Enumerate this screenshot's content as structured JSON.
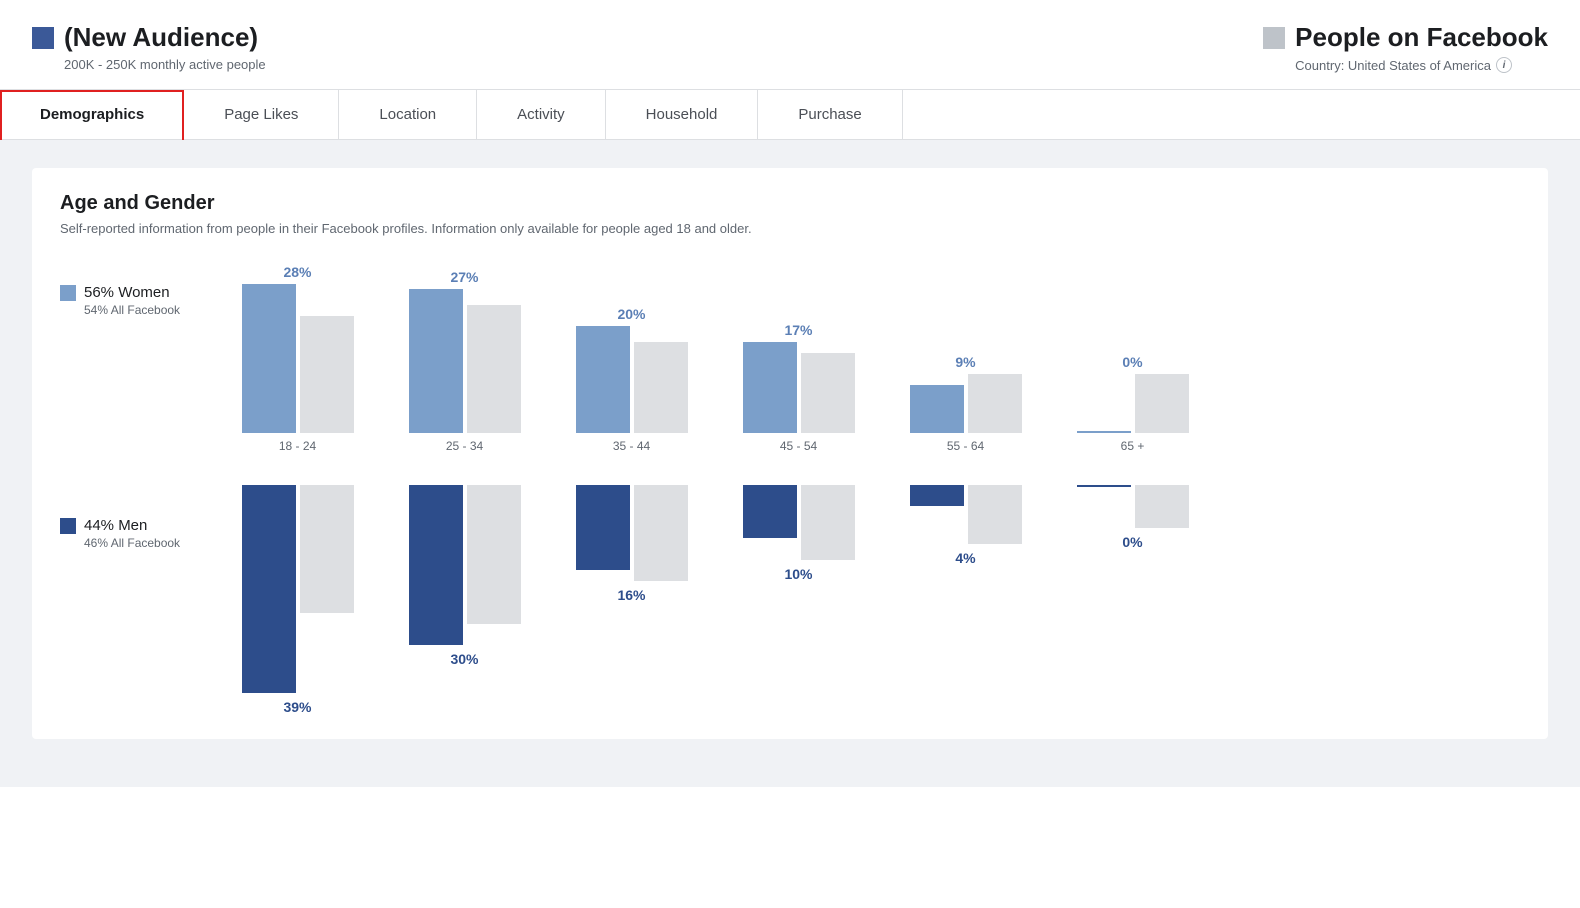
{
  "header": {
    "audience_icon_label": "audience-icon",
    "audience_title": "(New Audience)",
    "audience_subtitle": "200K - 250K monthly active people",
    "fb_icon_label": "facebook-icon",
    "fb_title": "People on Facebook",
    "fb_subtitle": "Country: United States of America"
  },
  "tabs": [
    {
      "id": "demographics",
      "label": "Demographics",
      "active": true
    },
    {
      "id": "page-likes",
      "label": "Page Likes",
      "active": false
    },
    {
      "id": "location",
      "label": "Location",
      "active": false
    },
    {
      "id": "activity",
      "label": "Activity",
      "active": false
    },
    {
      "id": "household",
      "label": "Household",
      "active": false
    },
    {
      "id": "purchase",
      "label": "Purchase",
      "active": false
    }
  ],
  "section": {
    "title": "Age and Gender",
    "description": "Self-reported information from people in their Facebook profiles. Information only available for people aged 18 and older."
  },
  "legend": {
    "women_pct": "56% Women",
    "women_all_fb": "54% All Facebook",
    "men_pct": "44% Men",
    "men_all_fb": "46% All Facebook"
  },
  "age_groups": [
    "18 - 24",
    "25 - 34",
    "35 - 44",
    "45 - 54",
    "55 - 64",
    "65 +"
  ],
  "women_data": [
    {
      "age": "18 - 24",
      "pct": 28,
      "all_fb_pct": 22
    },
    {
      "age": "25 - 34",
      "pct": 27,
      "all_fb_pct": 24
    },
    {
      "age": "35 - 44",
      "pct": 20,
      "all_fb_pct": 17
    },
    {
      "age": "45 - 54",
      "pct": 17,
      "all_fb_pct": 15
    },
    {
      "age": "55 - 64",
      "pct": 9,
      "all_fb_pct": 11
    },
    {
      "age": "65 +",
      "pct": 0,
      "all_fb_pct": 11
    }
  ],
  "men_data": [
    {
      "age": "18 - 24",
      "pct": 39,
      "all_fb_pct": 24
    },
    {
      "age": "25 - 34",
      "pct": 30,
      "all_fb_pct": 26
    },
    {
      "age": "35 - 44",
      "pct": 16,
      "all_fb_pct": 18
    },
    {
      "age": "45 - 54",
      "pct": 10,
      "all_fb_pct": 14
    },
    {
      "age": "55 - 64",
      "pct": 4,
      "all_fb_pct": 11
    },
    {
      "age": "65 +",
      "pct": 0,
      "all_fb_pct": 8
    }
  ],
  "colors": {
    "women_bar": "#7b9fca",
    "men_bar": "#2d4d8b",
    "all_fb_bar": "#dddfe2",
    "tab_active_border": "#e02020",
    "accent": "#3b5998"
  }
}
